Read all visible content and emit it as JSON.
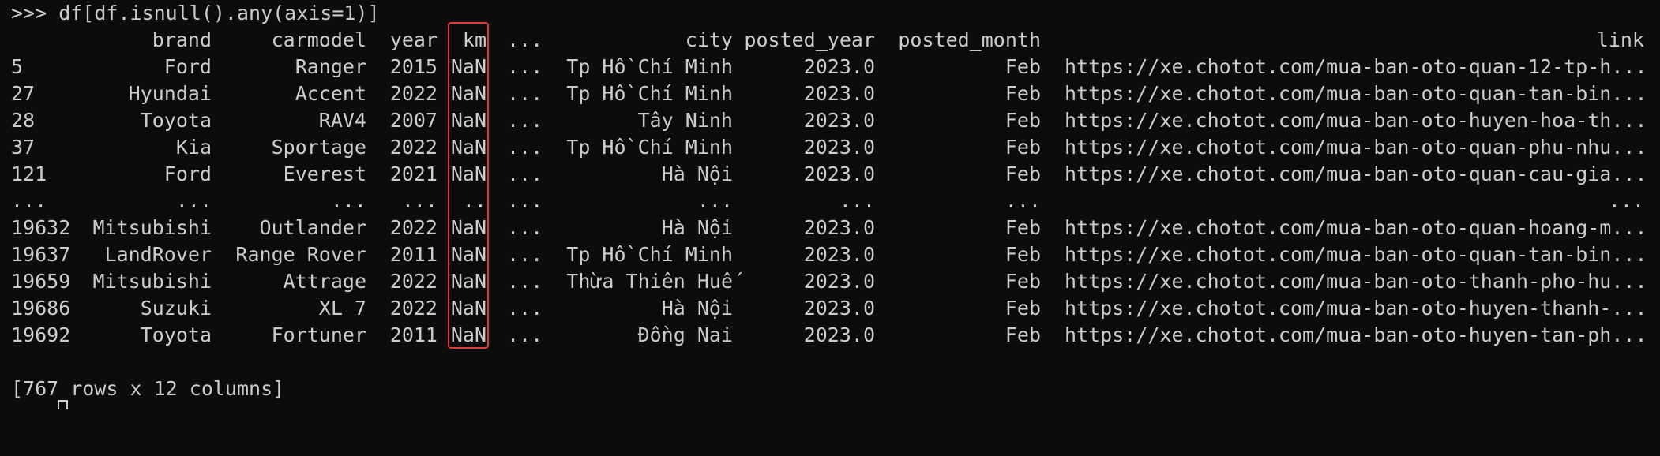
{
  "prompt": ">>> df[df.isnull().any(axis=1)]",
  "header": {
    "brand": "brand",
    "carmodel": "carmodel",
    "year": "year",
    "km": "km",
    "ellipsis": "...",
    "city": "city",
    "posted_year": "posted_year",
    "posted_month": "posted_month",
    "link": "link"
  },
  "rows": [
    {
      "idx": "5",
      "brand": "Ford",
      "carmodel": "Ranger",
      "year": "2015",
      "km": "NaN",
      "ellipsis": "...",
      "city": "Tp Hồ Chí Minh",
      "posted_year": "2023.0",
      "posted_month": "Feb",
      "link": "https://xe.chotot.com/mua-ban-oto-quan-12-tp-h..."
    },
    {
      "idx": "27",
      "brand": "Hyundai",
      "carmodel": "Accent",
      "year": "2022",
      "km": "NaN",
      "ellipsis": "...",
      "city": "Tp Hồ Chí Minh",
      "posted_year": "2023.0",
      "posted_month": "Feb",
      "link": "https://xe.chotot.com/mua-ban-oto-quan-tan-bin..."
    },
    {
      "idx": "28",
      "brand": "Toyota",
      "carmodel": "RAV4",
      "year": "2007",
      "km": "NaN",
      "ellipsis": "...",
      "city": "Tây Ninh",
      "posted_year": "2023.0",
      "posted_month": "Feb",
      "link": "https://xe.chotot.com/mua-ban-oto-huyen-hoa-th..."
    },
    {
      "idx": "37",
      "brand": "Kia",
      "carmodel": "Sportage",
      "year": "2022",
      "km": "NaN",
      "ellipsis": "...",
      "city": "Tp Hồ Chí Minh",
      "posted_year": "2023.0",
      "posted_month": "Feb",
      "link": "https://xe.chotot.com/mua-ban-oto-quan-phu-nhu..."
    },
    {
      "idx": "121",
      "brand": "Ford",
      "carmodel": "Everest",
      "year": "2021",
      "km": "NaN",
      "ellipsis": "...",
      "city": "Hà Nội",
      "posted_year": "2023.0",
      "posted_month": "Feb",
      "link": "https://xe.chotot.com/mua-ban-oto-quan-cau-gia..."
    },
    {
      "idx": "...",
      "brand": "...",
      "carmodel": "...",
      "year": "...",
      "km": "..",
      "ellipsis": "...",
      "city": "...",
      "posted_year": "...",
      "posted_month": "...",
      "link": "...",
      "link_align": "right"
    },
    {
      "idx": "19632",
      "brand": "Mitsubishi",
      "carmodel": "Outlander",
      "year": "2022",
      "km": "NaN",
      "ellipsis": "...",
      "city": "Hà Nội",
      "posted_year": "2023.0",
      "posted_month": "Feb",
      "link": "https://xe.chotot.com/mua-ban-oto-quan-hoang-m..."
    },
    {
      "idx": "19637",
      "brand": "LandRover",
      "carmodel": "Range Rover",
      "year": "2011",
      "km": "NaN",
      "ellipsis": "...",
      "city": "Tp Hồ Chí Minh",
      "posted_year": "2023.0",
      "posted_month": "Feb",
      "link": "https://xe.chotot.com/mua-ban-oto-quan-tan-bin..."
    },
    {
      "idx": "19659",
      "brand": "Mitsubishi",
      "carmodel": "Attrage",
      "year": "2022",
      "km": "NaN",
      "ellipsis": "...",
      "city": "Thừa Thiên Huế",
      "posted_year": "2023.0",
      "posted_month": "Feb",
      "link": "https://xe.chotot.com/mua-ban-oto-thanh-pho-hu..."
    },
    {
      "idx": "19686",
      "brand": "Suzuki",
      "carmodel": "XL 7",
      "year": "2022",
      "km": "NaN",
      "ellipsis": "...",
      "city": "Hà Nội",
      "posted_year": "2023.0",
      "posted_month": "Feb",
      "link": "https://xe.chotot.com/mua-ban-oto-huyen-thanh-..."
    },
    {
      "idx": "19692",
      "brand": "Toyota",
      "carmodel": "Fortuner",
      "year": "2011",
      "km": "NaN",
      "ellipsis": "...",
      "city": "Đồng Nai",
      "posted_year": "2023.0",
      "posted_month": "Feb",
      "link": "https://xe.chotot.com/mua-ban-oto-huyen-tan-ph..."
    }
  ],
  "summary": "[767 rows x 12 columns]",
  "colors": {
    "background": "#0c0c0c",
    "text": "#cccccc",
    "highlight": "#e03a3a"
  }
}
